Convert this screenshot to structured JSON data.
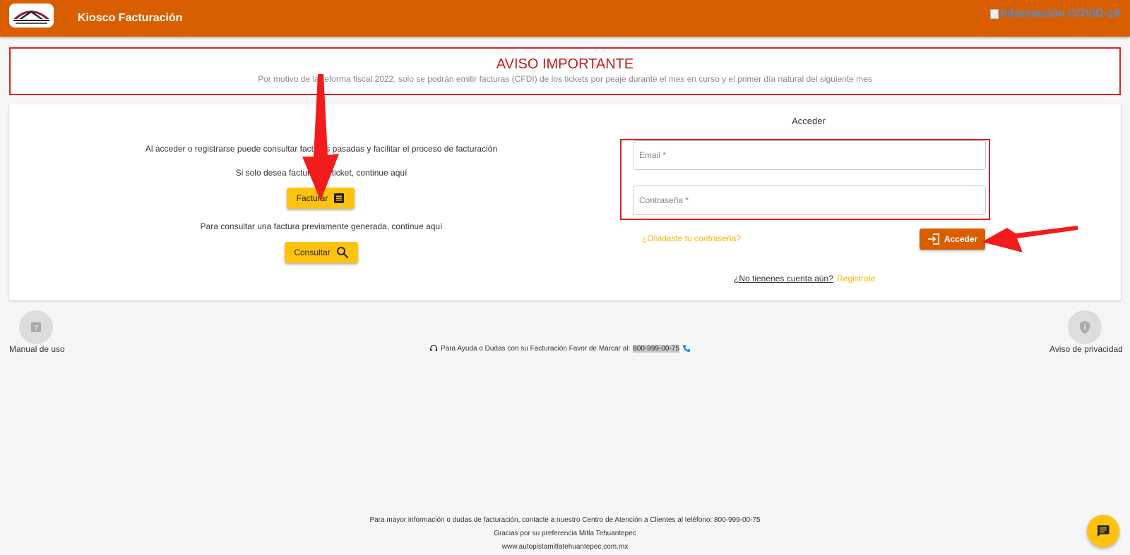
{
  "header": {
    "title": "Kiosco Facturación",
    "covid_link": "Información COVID-19",
    "brand_color": "#d95e00"
  },
  "notice": {
    "title": "AVISO IMPORTANTE",
    "text": "Por motivo de la reforma fiscal 2022, solo se podrán emitir facturas (CFDI) de los tickets por peaje durante el mes en curso y el primer día natural del siguiente mes"
  },
  "left": {
    "intro": "Al acceder o registrarse puede consultar facturas pasadas y facilitar el proceso de facturación",
    "invoice_prompt": "Si solo desea facturar un ticket, continue aquí",
    "invoice_button": "Facturar",
    "consult_prompt": "Para consultar una factura previamente generada, continue aquí",
    "consult_button": "Consultar"
  },
  "login": {
    "title": "Acceder",
    "email_placeholder": "Email *",
    "password_placeholder": "Contraseña *",
    "forgot_link": "¿Olvidaste tu contraseña?",
    "submit_button": "Acceder",
    "no_account": "¿No tienenes cuenta aún?",
    "register_link": "Registrate"
  },
  "help": {
    "manual_label": "Manual de uso",
    "privacy_label": "Aviso de privacidad",
    "help_text": "Para Ayuda o Dudas con su Facturación Favor de Marcar al:",
    "phone": "800-999-00-75"
  },
  "footer": {
    "line1": "Para mayor información o dudas de facturación, contacte a nuestro Centro de Atención a Clientes al teléfono: 800-999-00-75",
    "line2": "Gracias por su preferencia Mitla Tehuantepec",
    "line3": "www.autopistamitlatehuantepec.com.mx"
  },
  "colors": {
    "accent_yellow": "#ffc20e",
    "alert_red": "#e02020"
  }
}
